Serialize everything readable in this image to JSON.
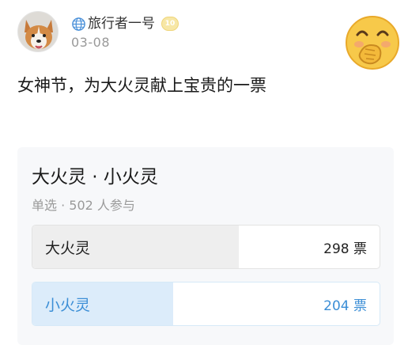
{
  "post": {
    "username": "旅行者一号",
    "level_badge": "10",
    "date": "03-08",
    "text": "女神节，为大火灵献上宝贵的一票",
    "avatar_icon": "corgi-avatar-icon",
    "sticker_icon": "covering-mouth-emoji-icon"
  },
  "poll": {
    "title": "大火灵 · 小火灵",
    "subtitle": "单选 · 502 人参与",
    "total_votes": 502,
    "options": [
      {
        "label": "大火灵",
        "votes_text": "298 票",
        "votes": 298,
        "fill_percent": 59.4,
        "fill_color": "#eeeeee"
      },
      {
        "label": "小火灵",
        "votes_text": "204 票",
        "votes": 204,
        "fill_percent": 40.6,
        "fill_color": "#dcecfa"
      }
    ]
  },
  "colors": {
    "accent": "#3b8ed6",
    "muted_text": "#9a9a9a",
    "badge": "#f7e7a6"
  }
}
